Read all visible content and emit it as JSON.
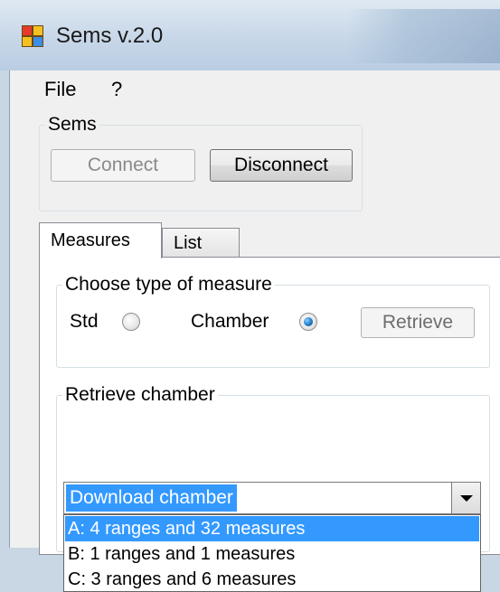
{
  "window": {
    "title": "Sems v.2.0"
  },
  "menu": {
    "items": [
      "File",
      "?"
    ]
  },
  "sems_group": {
    "label": "Sems",
    "connect_label": "Connect",
    "disconnect_label": "Disconnect"
  },
  "tabs": [
    {
      "label": "Measures",
      "active": true
    },
    {
      "label": "List",
      "active": false
    }
  ],
  "measure_type": {
    "label": "Choose type of measure",
    "std_label": "Std",
    "chamber_label": "Chamber",
    "selected": "Chamber",
    "retrieve_label": "Retrieve"
  },
  "retrieve_chamber": {
    "label": "Retrieve chamber",
    "combo_value": "Download chamber",
    "options": [
      "A: 4 ranges and 32 measures",
      "B: 1 ranges and 1 measures",
      "C: 3 ranges and 6 measures"
    ],
    "highlighted_option": 0
  },
  "colors": {
    "selection": "#3399ff",
    "radio_selected": "#2a8ad4"
  }
}
